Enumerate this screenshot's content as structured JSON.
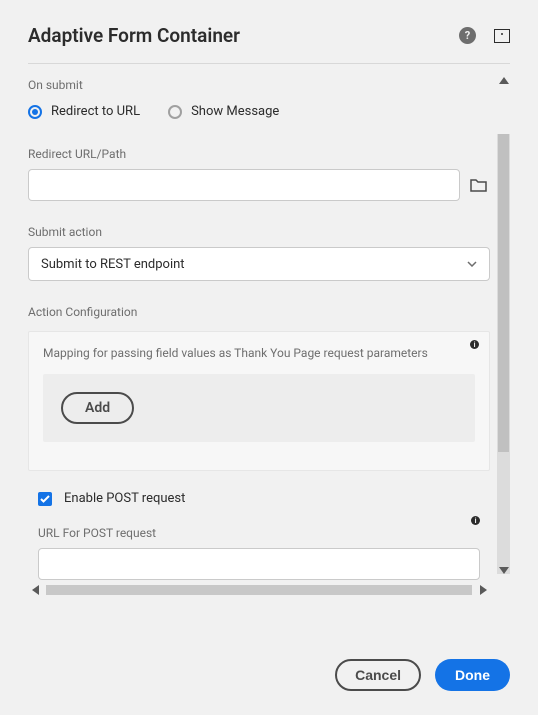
{
  "header": {
    "title": "Adaptive Form Container"
  },
  "onSubmit": {
    "heading": "On submit",
    "options": {
      "redirect": "Redirect to URL",
      "showMessage": "Show Message"
    }
  },
  "redirect": {
    "label": "Redirect URL/Path",
    "value": ""
  },
  "submitAction": {
    "label": "Submit action",
    "selected": "Submit to REST endpoint"
  },
  "actionConfig": {
    "heading": "Action Configuration",
    "mappingText": "Mapping for passing field values as Thank You Page request parameters",
    "addLabel": "Add"
  },
  "enablePost": {
    "label": "Enable POST request"
  },
  "postUrl": {
    "label": "URL For POST request",
    "value": ""
  },
  "footer": {
    "cancel": "Cancel",
    "done": "Done"
  }
}
